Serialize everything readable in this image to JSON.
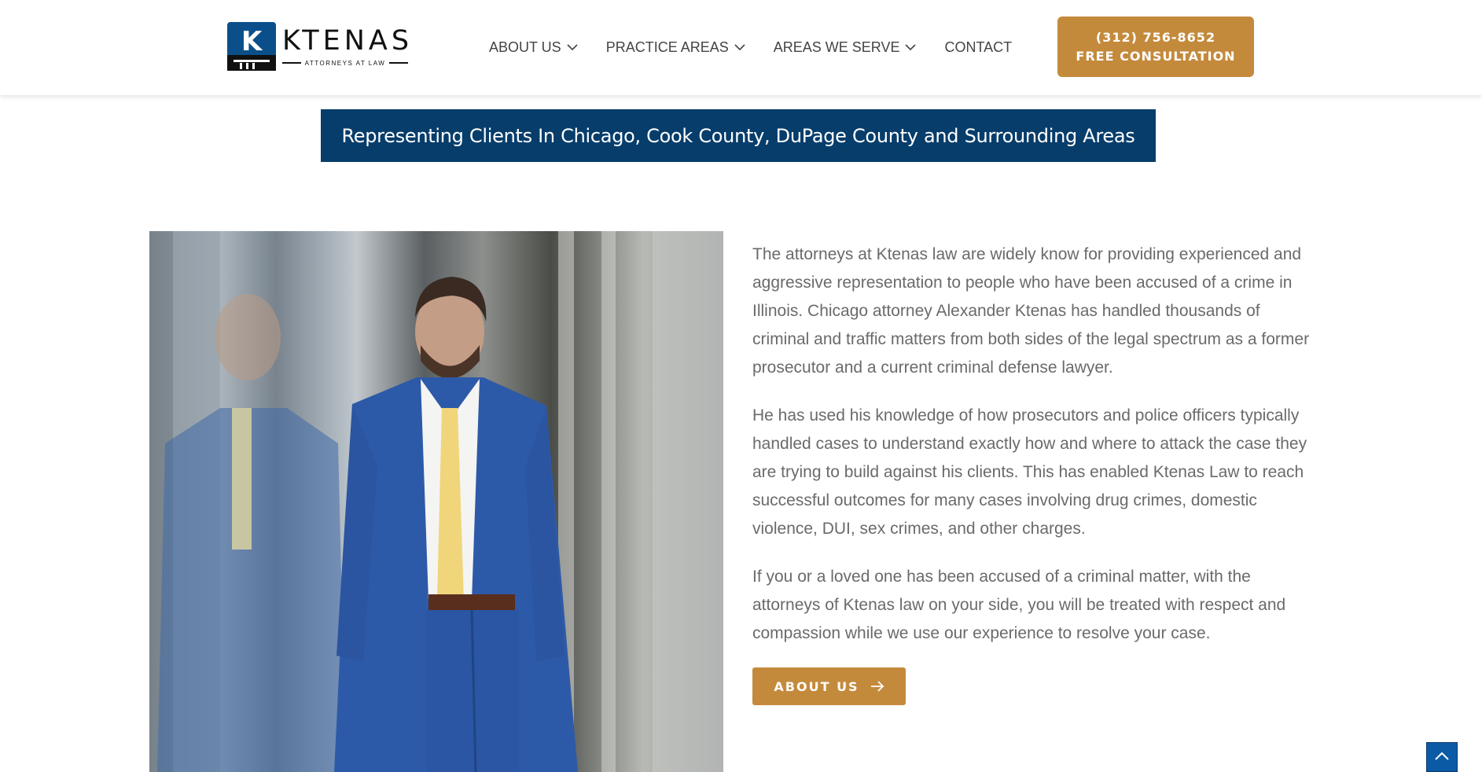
{
  "brand": {
    "name": "KTENAS",
    "tagline": "ATTORNEYS AT LAW",
    "mark_letter": "K",
    "colors": {
      "navy": "#073d6b",
      "gold": "#c48a3c",
      "text": "#6a6a6a"
    }
  },
  "nav": {
    "items": [
      {
        "label": "ABOUT US",
        "has_dropdown": true,
        "icon": "chevron-down-icon"
      },
      {
        "label": "PRACTICE AREAS",
        "has_dropdown": true,
        "icon": "chevron-down-icon"
      },
      {
        "label": "AREAS WE SERVE",
        "has_dropdown": true,
        "icon": "chevron-down-icon"
      },
      {
        "label": "CONTACT",
        "has_dropdown": false
      }
    ]
  },
  "cta": {
    "phone": "(312) 756-8652",
    "label": "FREE CONSULTATION"
  },
  "banner": {
    "text": "Representing Clients In Chicago, Cook County, DuPage County and Surrounding Areas"
  },
  "main": {
    "paragraphs": [
      "The attorneys at Ktenas law are widely know for providing experienced and aggressive representation to people who have been accused of a crime in Illinois. Chicago attorney Alexander Ktenas has handled thousands of criminal and traffic matters from both sides of the legal spectrum as a former prosecutor and a current criminal defense lawyer.",
      "He has used his knowledge of how prosecutors and police officers typically handled cases to understand exactly how and where to attack the case they are trying to build against his clients. This has enabled Ktenas Law to reach successful outcomes for many cases involving drug crimes, domestic violence, DUI, sex crimes, and other charges.",
      "If you or a loved one has been accused of a criminal matter, with the attorneys of Ktenas law on your side, you will be treated with respect and compassion while we use our experience to resolve your case."
    ],
    "button_label": "ABOUT US",
    "button_icon": "arrow-right-icon"
  },
  "scroll_top": {
    "icon": "chevron-up-icon"
  }
}
